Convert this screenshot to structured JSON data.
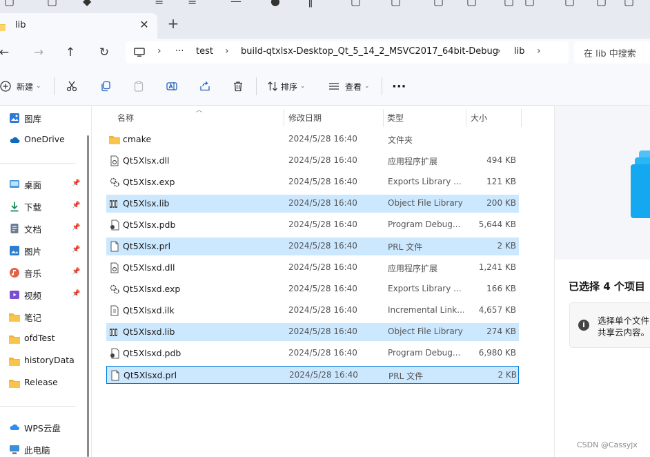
{
  "tab": {
    "label": "lib",
    "close_glyph": "✕",
    "new_glyph": "+"
  },
  "address": {
    "ellipsis": "···",
    "crumbs": [
      "test",
      "build-qtxlsx-Desktop_Qt_5_14_2_MSVC2017_64bit-Debug",
      "lib"
    ],
    "separator": "›"
  },
  "search": {
    "placeholder": "在 lib 中搜索"
  },
  "toolbar": {
    "new_label": "新建",
    "sort_label": "排序",
    "view_label": "查看",
    "more_glyph": "···"
  },
  "sidebar": {
    "items": [
      {
        "label": "图库",
        "icon": "gallery-icon",
        "pinned": false
      },
      {
        "label": "OneDrive",
        "icon": "onedrive-icon",
        "pinned": false
      },
      {
        "label": "桌面",
        "icon": "desktop-icon",
        "pinned": true
      },
      {
        "label": "下载",
        "icon": "download-icon",
        "pinned": true
      },
      {
        "label": "文档",
        "icon": "documents-icon",
        "pinned": true
      },
      {
        "label": "图片",
        "icon": "pictures-icon",
        "pinned": true
      },
      {
        "label": "音乐",
        "icon": "music-icon",
        "pinned": true
      },
      {
        "label": "视频",
        "icon": "videos-icon",
        "pinned": true
      },
      {
        "label": "笔记",
        "icon": "folder-icon",
        "pinned": false
      },
      {
        "label": "ofdTest",
        "icon": "folder-icon",
        "pinned": false
      },
      {
        "label": "historyData",
        "icon": "folder-icon",
        "pinned": false
      },
      {
        "label": "Release",
        "icon": "folder-icon",
        "pinned": false
      },
      {
        "label": "WPS云盘",
        "icon": "wps-cloud-icon",
        "pinned": false
      },
      {
        "label": "此电脑",
        "icon": "this-pc-icon",
        "pinned": false
      }
    ]
  },
  "columns": {
    "name": "名称",
    "date": "修改日期",
    "type": "类型",
    "size": "大小"
  },
  "files": [
    {
      "name": "cmake",
      "date": "2024/5/28 16:40",
      "type": "文件夹",
      "size": "",
      "icon": "folder-icon",
      "selected": false
    },
    {
      "name": "Qt5Xlsx.dll",
      "date": "2024/5/28 16:40",
      "type": "应用程序扩展",
      "size": "494 KB",
      "icon": "dll-icon",
      "selected": false
    },
    {
      "name": "Qt5Xlsx.exp",
      "date": "2024/5/28 16:40",
      "type": "Exports Library ...",
      "size": "121 KB",
      "icon": "exp-icon",
      "selected": false
    },
    {
      "name": "Qt5Xlsx.lib",
      "date": "2024/5/28 16:40",
      "type": "Object File Library",
      "size": "200 KB",
      "icon": "lib-icon",
      "selected": true
    },
    {
      "name": "Qt5Xlsx.pdb",
      "date": "2024/5/28 16:40",
      "type": "Program Debug...",
      "size": "5,644 KB",
      "icon": "pdb-icon",
      "selected": false
    },
    {
      "name": "Qt5Xlsx.prl",
      "date": "2024/5/28 16:40",
      "type": "PRL 文件",
      "size": "2 KB",
      "icon": "file-icon",
      "selected": true
    },
    {
      "name": "Qt5Xlsxd.dll",
      "date": "2024/5/28 16:40",
      "type": "应用程序扩展",
      "size": "1,241 KB",
      "icon": "dll-icon",
      "selected": false
    },
    {
      "name": "Qt5Xlsxd.exp",
      "date": "2024/5/28 16:40",
      "type": "Exports Library ...",
      "size": "166 KB",
      "icon": "exp-icon",
      "selected": false
    },
    {
      "name": "Qt5Xlsxd.ilk",
      "date": "2024/5/28 16:40",
      "type": "Incremental Link...",
      "size": "4,657 KB",
      "icon": "ilk-icon",
      "selected": false
    },
    {
      "name": "Qt5Xlsxd.lib",
      "date": "2024/5/28 16:40",
      "type": "Object File Library",
      "size": "274 KB",
      "icon": "lib-icon",
      "selected": true
    },
    {
      "name": "Qt5Xlsxd.pdb",
      "date": "2024/5/28 16:40",
      "type": "Program Debug...",
      "size": "6,980 KB",
      "icon": "pdb-icon",
      "selected": false
    },
    {
      "name": "Qt5Xlsxd.prl",
      "date": "2024/5/28 16:40",
      "type": "PRL 文件",
      "size": "2 KB",
      "icon": "file-icon",
      "selected": true
    }
  ],
  "details": {
    "selection_title": "已选择 4 个项目",
    "info_line1": "选择单个文件",
    "info_line2": "共享云内容。"
  },
  "watermark": "CSDN @Cassyjx",
  "colors": {
    "selection": "#cce8ff",
    "accent": "#0078d4",
    "folder": "#f8c44a"
  }
}
